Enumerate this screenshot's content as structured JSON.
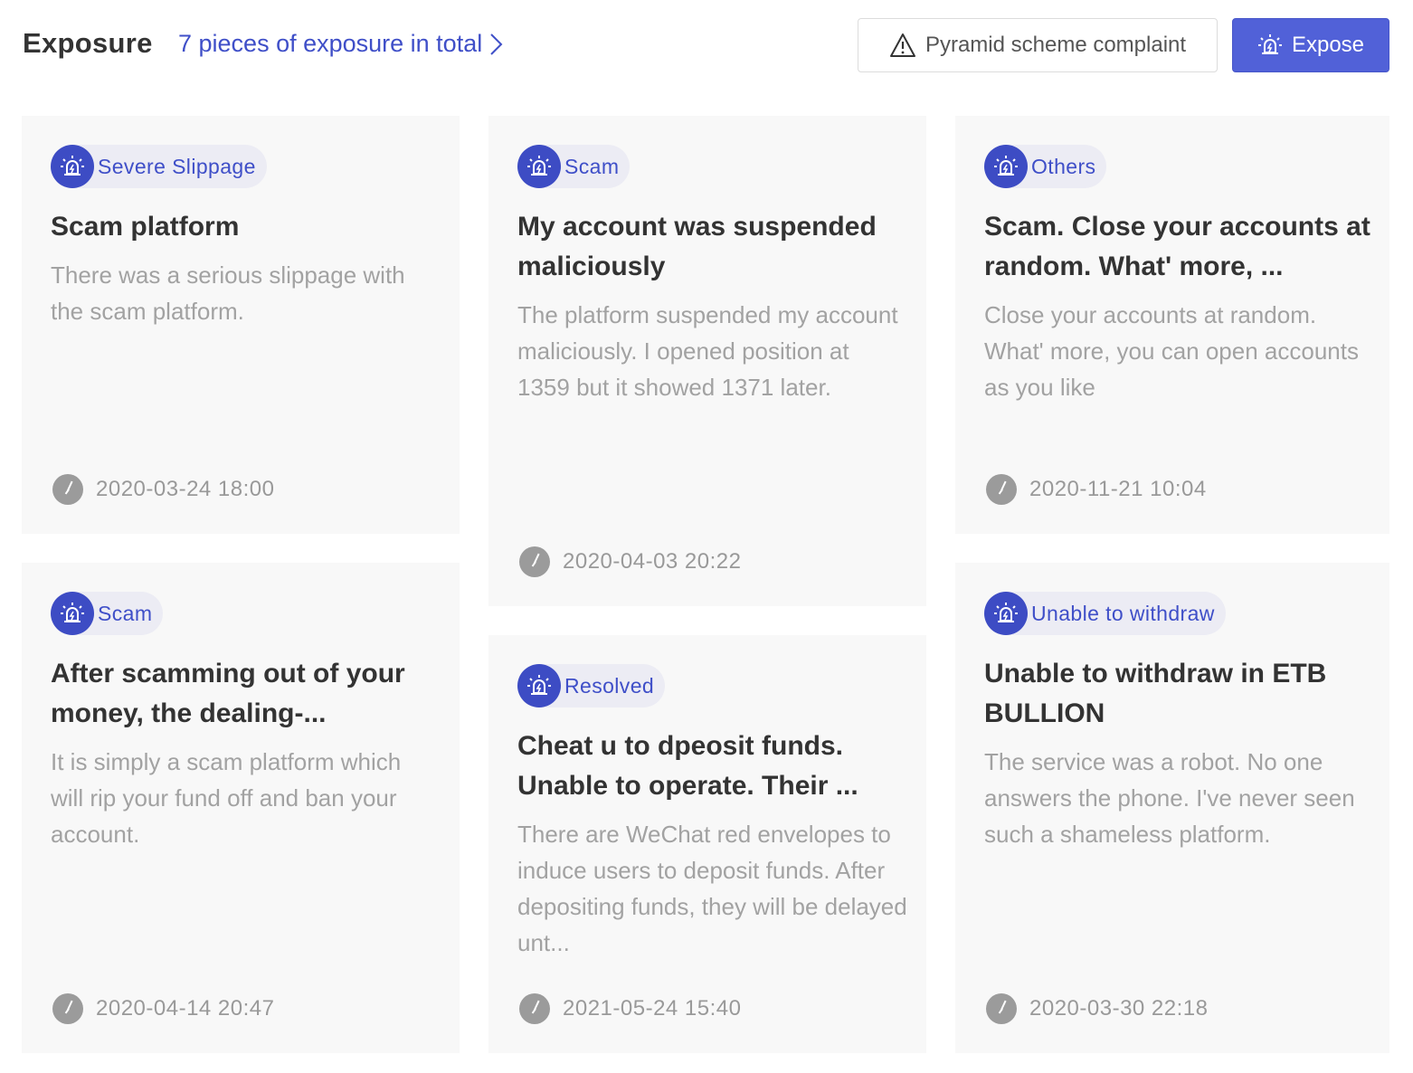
{
  "header": {
    "title": "Exposure",
    "total_link": "7 pieces of exposure in total",
    "complaint_button": "Pyramid scheme complaint",
    "expose_button": "Expose"
  },
  "colors": {
    "accent": "#3f4fc8",
    "primary_button": "#5161d8",
    "card_bg": "#f8f8f8",
    "tag_bg": "#ececf4"
  },
  "icons": {
    "tag": "alarm-siren-icon",
    "time": "clock-icon",
    "complaint": "warning-triangle-icon",
    "link": "chevron-right-icon"
  },
  "cards": [
    {
      "tag": "Severe Slippage",
      "title": "Scam platform",
      "description": "There was a serious slippage with the scam platform.",
      "time": "2020-03-24 18:00"
    },
    {
      "tag": "Scam",
      "title": "My account was suspended maliciously",
      "description": "The platform suspended my account maliciously. I opened position at 1359 but it showed 1371 later.",
      "time": "2020-04-03 20:22"
    },
    {
      "tag": "Others",
      "title": "Scam. Close your accounts at random. What' more, ...",
      "description": "Close your accounts at random. What' more, you can open accounts as you like",
      "time": "2020-11-21 10:04"
    },
    {
      "tag": "Scam",
      "title": "After scamming out of your money, the dealing-...",
      "description": "It is simply a scam platform which will rip your fund off and ban your account.",
      "time": "2020-04-14 20:47"
    },
    {
      "tag": "Resolved",
      "title": "Cheat u to dpeosit funds. Unable to operate. Their ...",
      "description": "There are WeChat red envelopes to induce users to deposit funds. After depositing funds, they will be delayed unt...",
      "time": "2021-05-24 15:40"
    },
    {
      "tag": "Unable to withdraw",
      "title": "Unable to withdraw in ETB BULLION",
      "description": "The service was a robot. No one answers the phone. I've never seen such a shameless platform.",
      "time": "2020-03-30 22:18"
    }
  ]
}
